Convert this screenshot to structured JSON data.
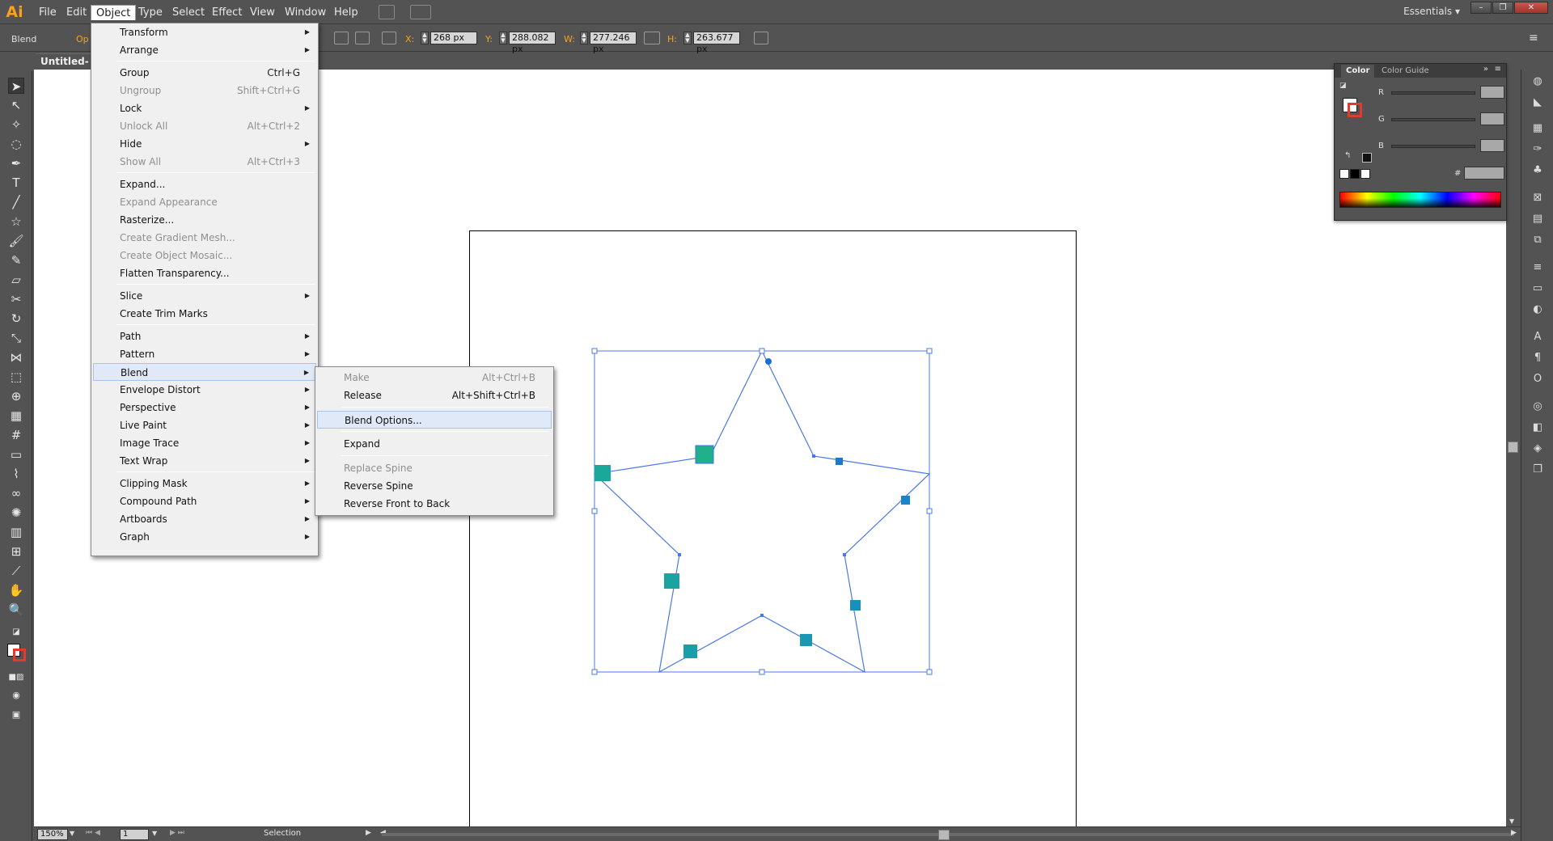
{
  "app": {
    "logo": "Ai",
    "workspace": "Essentials"
  },
  "menubar": {
    "items": [
      "File",
      "Edit",
      "Object",
      "Type",
      "Select",
      "Effect",
      "View",
      "Window",
      "Help"
    ],
    "active": "Object"
  },
  "window_buttons": {
    "minimize": "–",
    "restore": "❐",
    "close": "✕"
  },
  "controlbar": {
    "selection_label": "Blend",
    "opacity_label": "Op",
    "x_label": "X:",
    "x_value": "268 px",
    "y_label": "Y:",
    "y_value": "288.082 px",
    "w_label": "W:",
    "w_value": "277.246 px",
    "h_label": "H:",
    "h_value": "263.677 px"
  },
  "document": {
    "tab_title": "Untitled-1*"
  },
  "object_menu": {
    "items": [
      {
        "label": "Transform",
        "shortcut": "",
        "submenu": true,
        "disabled": false
      },
      {
        "label": "Arrange",
        "shortcut": "",
        "submenu": true,
        "disabled": false
      },
      {
        "label": "Group",
        "shortcut": "Ctrl+G",
        "submenu": false,
        "disabled": false
      },
      {
        "label": "Ungroup",
        "shortcut": "Shift+Ctrl+G",
        "submenu": false,
        "disabled": true
      },
      {
        "label": "Lock",
        "shortcut": "",
        "submenu": true,
        "disabled": false
      },
      {
        "label": "Unlock All",
        "shortcut": "Alt+Ctrl+2",
        "submenu": false,
        "disabled": true
      },
      {
        "label": "Hide",
        "shortcut": "",
        "submenu": true,
        "disabled": false
      },
      {
        "label": "Show All",
        "shortcut": "Alt+Ctrl+3",
        "submenu": false,
        "disabled": true
      },
      {
        "label": "Expand...",
        "shortcut": "",
        "submenu": false,
        "disabled": false
      },
      {
        "label": "Expand Appearance",
        "shortcut": "",
        "submenu": false,
        "disabled": true
      },
      {
        "label": "Rasterize...",
        "shortcut": "",
        "submenu": false,
        "disabled": false
      },
      {
        "label": "Create Gradient Mesh...",
        "shortcut": "",
        "submenu": false,
        "disabled": true
      },
      {
        "label": "Create Object Mosaic...",
        "shortcut": "",
        "submenu": false,
        "disabled": true
      },
      {
        "label": "Flatten Transparency...",
        "shortcut": "",
        "submenu": false,
        "disabled": false
      },
      {
        "label": "Slice",
        "shortcut": "",
        "submenu": true,
        "disabled": false
      },
      {
        "label": "Create Trim Marks",
        "shortcut": "",
        "submenu": false,
        "disabled": false
      },
      {
        "label": "Path",
        "shortcut": "",
        "submenu": true,
        "disabled": false
      },
      {
        "label": "Pattern",
        "shortcut": "",
        "submenu": true,
        "disabled": false
      },
      {
        "label": "Blend",
        "shortcut": "",
        "submenu": true,
        "disabled": false,
        "highlighted": true
      },
      {
        "label": "Envelope Distort",
        "shortcut": "",
        "submenu": true,
        "disabled": false
      },
      {
        "label": "Perspective",
        "shortcut": "",
        "submenu": true,
        "disabled": false
      },
      {
        "label": "Live Paint",
        "shortcut": "",
        "submenu": true,
        "disabled": false
      },
      {
        "label": "Image Trace",
        "shortcut": "",
        "submenu": true,
        "disabled": false
      },
      {
        "label": "Text Wrap",
        "shortcut": "",
        "submenu": true,
        "disabled": false
      },
      {
        "label": "Clipping Mask",
        "shortcut": "",
        "submenu": true,
        "disabled": false
      },
      {
        "label": "Compound Path",
        "shortcut": "",
        "submenu": true,
        "disabled": false
      },
      {
        "label": "Artboards",
        "shortcut": "",
        "submenu": true,
        "disabled": false
      },
      {
        "label": "Graph",
        "shortcut": "",
        "submenu": true,
        "disabled": false
      }
    ]
  },
  "blend_submenu": {
    "items": [
      {
        "label": "Make",
        "shortcut": "Alt+Ctrl+B",
        "disabled": true
      },
      {
        "label": "Release",
        "shortcut": "Alt+Shift+Ctrl+B",
        "disabled": false
      },
      {
        "label": "Blend Options...",
        "shortcut": "",
        "disabled": false,
        "highlighted": true
      },
      {
        "label": "Expand",
        "shortcut": "",
        "disabled": false
      },
      {
        "label": "Replace Spine",
        "shortcut": "",
        "disabled": true
      },
      {
        "label": "Reverse Spine",
        "shortcut": "",
        "disabled": false
      },
      {
        "label": "Reverse Front to Back",
        "shortcut": "",
        "disabled": false
      }
    ]
  },
  "color_panel": {
    "tabs": [
      "Color",
      "Color Guide"
    ],
    "channels": [
      "R",
      "G",
      "B"
    ],
    "hex_label": "#"
  },
  "statusbar": {
    "zoom": "150%",
    "artboard_number": "1",
    "tool_name": "Selection"
  },
  "colors": {
    "accent_orange": "#f7a21b",
    "selection_blue": "#3f6fe0",
    "blend_teal": "#1aa89a",
    "blend_blue": "#1a6fd0"
  }
}
